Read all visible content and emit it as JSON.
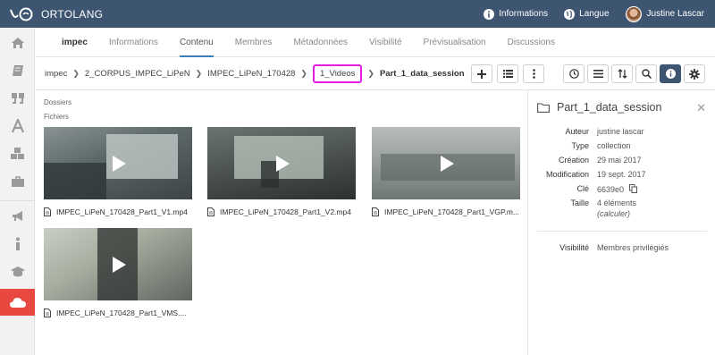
{
  "app": {
    "name": "ORTOLANG"
  },
  "topbar": {
    "info_label": "Informations",
    "lang_label": "Langue",
    "user_name": "Justine Lascar"
  },
  "sidebar": {
    "items": [
      {
        "icon": "home-icon"
      },
      {
        "icon": "book-icon"
      },
      {
        "icon": "quote-icon"
      },
      {
        "icon": "letter-a-icon"
      },
      {
        "icon": "cubes-icon"
      },
      {
        "icon": "briefcase-icon"
      },
      {
        "icon": "megaphone-icon"
      },
      {
        "icon": "info-icon"
      },
      {
        "icon": "graduation-cap-icon"
      },
      {
        "icon": "cloud-icon",
        "active": true
      }
    ],
    "active_color": "#e8483f"
  },
  "tabs": [
    {
      "label": "impec"
    },
    {
      "label": "Informations"
    },
    {
      "label": "Contenu",
      "active": true
    },
    {
      "label": "Membres"
    },
    {
      "label": "Métadonnées"
    },
    {
      "label": "Visibilité"
    },
    {
      "label": "Prévisualisation"
    },
    {
      "label": "Discussions"
    }
  ],
  "breadcrumb": {
    "items": [
      "impec",
      "2_CORPUS_IMPEC_LiPeN",
      "IMPEC_LiPeN_170428",
      "1_Videos"
    ],
    "current": "Part_1_data_session"
  },
  "content": {
    "folders_label": "Dossiers",
    "files_label": "Fichiers",
    "files": [
      {
        "name": "IMPEC_LiPeN_170428_Part1_V1.mp4"
      },
      {
        "name": "IMPEC_LiPeN_170428_Part1_V2.mp4"
      },
      {
        "name": "IMPEC_LiPeN_170428_Part1_VGP.m..."
      },
      {
        "name": "IMPEC_LiPeN_170428_Part1_VMS...."
      }
    ]
  },
  "panel": {
    "title": "Part_1_data_session",
    "props": [
      {
        "key": "Auteur",
        "value": "justine lascar"
      },
      {
        "key": "Type",
        "value": "collection"
      },
      {
        "key": "Création",
        "value": "29 mai 2017"
      },
      {
        "key": "Modification",
        "value": "19 sept. 2017"
      },
      {
        "key": "Clé",
        "value": "6639e0"
      },
      {
        "key": "Taille",
        "value": "4 éléments",
        "sub": "(calculer)"
      }
    ],
    "visibility_key": "Visibilité",
    "visibility_value": "Membres privilégiés"
  },
  "colors": {
    "topbar": "#3d5571",
    "highlight": "#e21fe0",
    "tab_underline": "#3d7fb9"
  }
}
